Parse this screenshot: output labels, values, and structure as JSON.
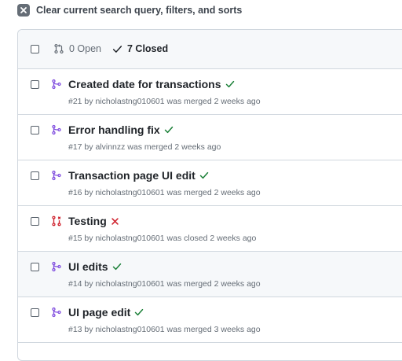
{
  "clear_filter": {
    "label": "Clear current search query, filters, and sorts"
  },
  "header": {
    "open_label": "0 Open",
    "closed_label": "7 Closed"
  },
  "colors": {
    "merged": "#8250df",
    "closed": "#cf222e",
    "check": "#1a7f37",
    "muted": "#656d76"
  },
  "pulls": [
    {
      "title": "Created date for transactions",
      "meta": "#21 by nicholastng010601 was merged 2 weeks ago",
      "state": "merged",
      "status": "success",
      "shaded": false
    },
    {
      "title": "Error handling fix",
      "meta": "#17 by alvinnzz was merged 2 weeks ago",
      "state": "merged",
      "status": "success",
      "shaded": false
    },
    {
      "title": "Transaction page UI edit",
      "meta": "#16 by nicholastng010601 was merged 2 weeks ago",
      "state": "merged",
      "status": "success",
      "shaded": false
    },
    {
      "title": "Testing",
      "meta": "#15 by nicholastng010601 was closed 2 weeks ago",
      "state": "closed",
      "status": "failure",
      "shaded": false
    },
    {
      "title": "UI edits",
      "meta": "#14 by nicholastng010601 was merged 2 weeks ago",
      "state": "merged",
      "status": "success",
      "shaded": true
    },
    {
      "title": "UI page edit",
      "meta": "#13 by nicholastng010601 was merged 3 weeks ago",
      "state": "merged",
      "status": "success",
      "shaded": false
    }
  ]
}
